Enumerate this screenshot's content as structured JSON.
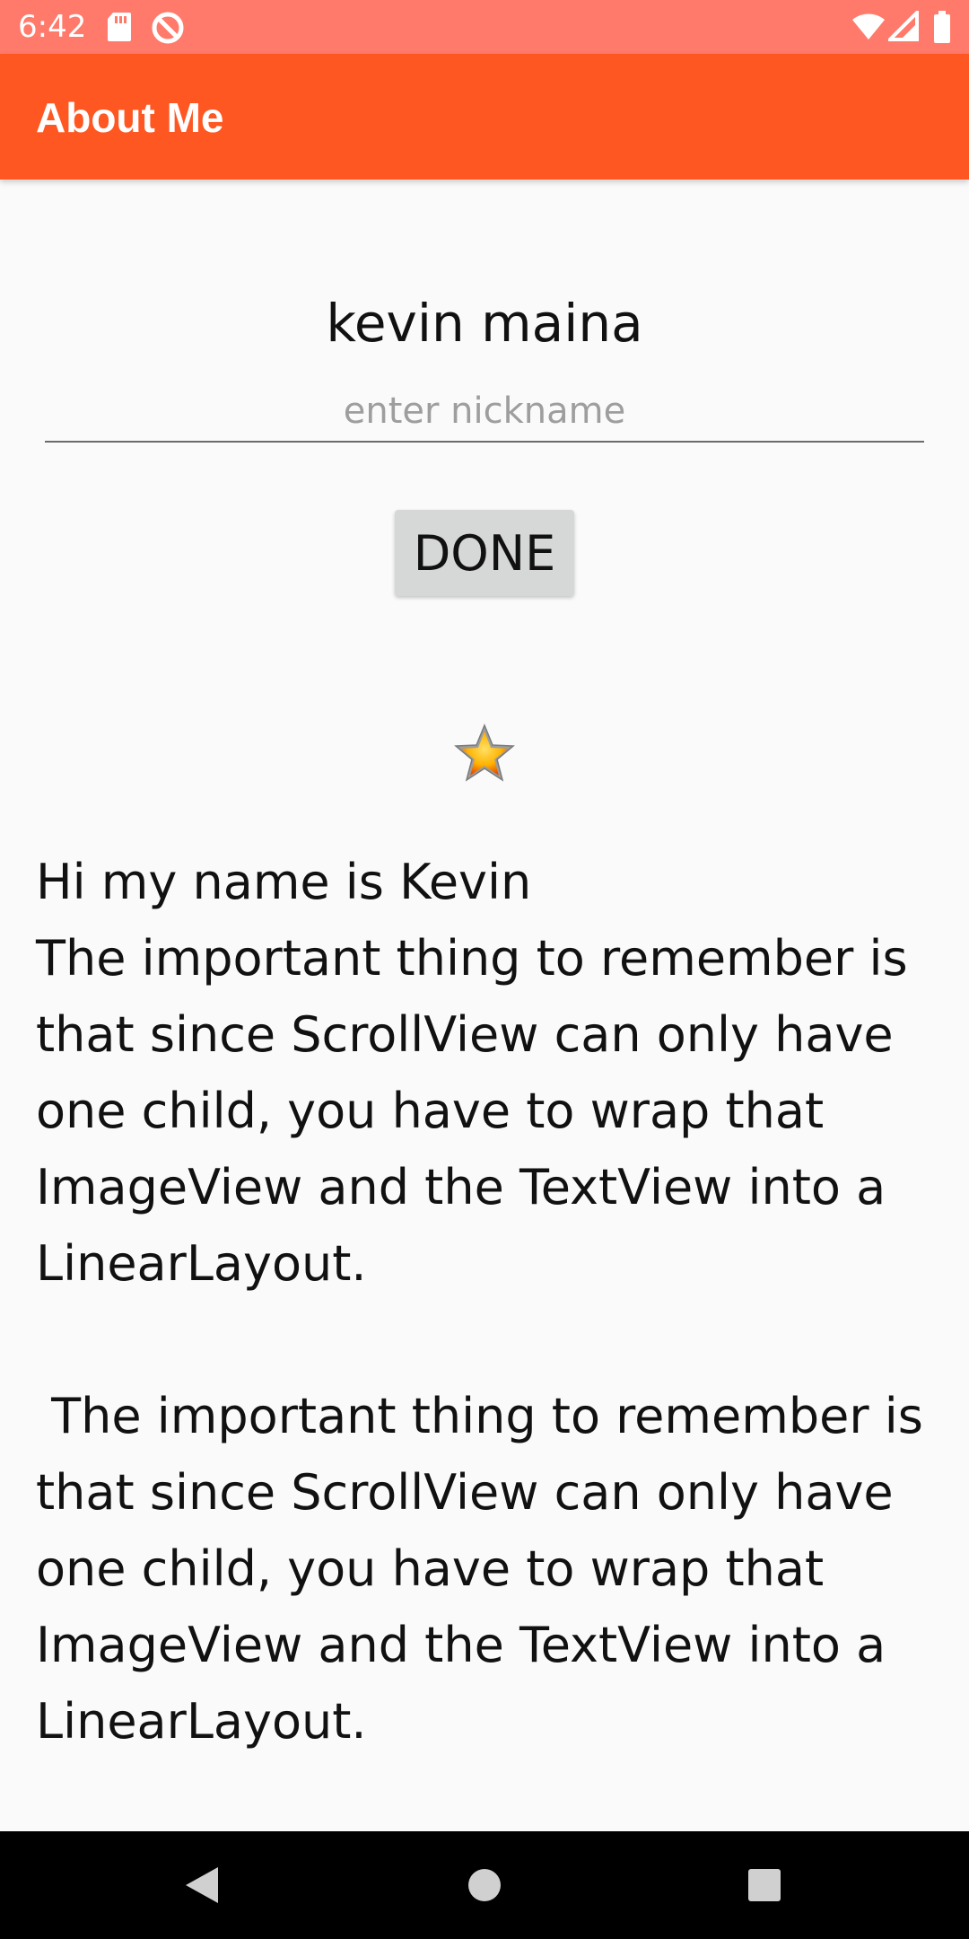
{
  "status_bar": {
    "time": "6:42",
    "icons_left": [
      "sd-card-icon",
      "do-not-disturb-icon"
    ],
    "icons_right": [
      "wifi-icon",
      "signal-icon",
      "battery-icon"
    ],
    "color": "#ff7a6b"
  },
  "app_bar": {
    "title": "About Me",
    "color": "#ff5722"
  },
  "profile": {
    "name": "kevin maina",
    "nickname_placeholder": "enter nickname",
    "nickname_value": "",
    "done_label": "DONE",
    "star_icon": "star-icon"
  },
  "bio": {
    "text": "Hi my name is Kevin\nThe important thing to remember is that since ScrollView can only have one child, you have to wrap that ImageView and the TextView into a LinearLayout.\n\n The important thing to remember is that since ScrollView can only have one child, you have to wrap that ImageView and the TextView into a LinearLayout."
  },
  "nav_bar": {
    "buttons": [
      "back-icon",
      "home-icon",
      "recents-icon"
    ]
  }
}
